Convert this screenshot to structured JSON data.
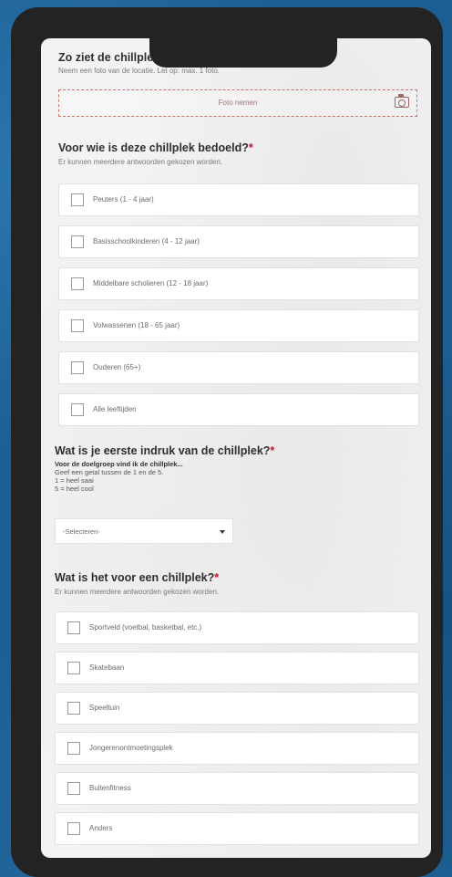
{
  "photo_section": {
    "title": "Zo ziet de chillplek er uit",
    "hint": "Neem een foto van de locatie. Let op: max. 1 foto.",
    "button_label": "Foto nemen",
    "icon": "camera-icon"
  },
  "audience": {
    "title": "Voor wie is deze chillplek bedoeld?",
    "required_mark": "*",
    "hint": "Er kunnen meerdere antwoorden gekozen worden.",
    "options": [
      "Peuters (1 - 4 jaar)",
      "Basisschoolkinderen (4 - 12 jaar)",
      "Middelbare scholieren (12 - 18 jaar)",
      "Volwassenen (18 - 65 jaar)",
      "Ouderen (65+)",
      "Alle leeftijden"
    ]
  },
  "impression": {
    "title": "Wat is je eerste indruk van de chillplek?",
    "required_mark": "*",
    "bold_hint": "Voor de doelgroep vind ik de chillplek...",
    "hint_line1": "Geef een getal tussen de 1 en de 5.",
    "hint_line2": "1 = heel saai",
    "hint_line3": "5 = heel cool",
    "select_value": "-Selecteren-"
  },
  "type": {
    "title": "Wat is het voor een chillplek?",
    "required_mark": "*",
    "hint": "Er kunnen meerdere antwoorden gekozen worden.",
    "options": [
      "Sportveld (voetbal, basketbal, etc.)",
      "Skatebaan",
      "Speeltuin",
      "Jongerenontmoetingsplek",
      "Buitenfitness",
      "Anders"
    ]
  },
  "colors": {
    "background": "#1d5f93",
    "phone_frame": "#232323",
    "required": "#c8102e",
    "photo_border": "#c5746c"
  }
}
